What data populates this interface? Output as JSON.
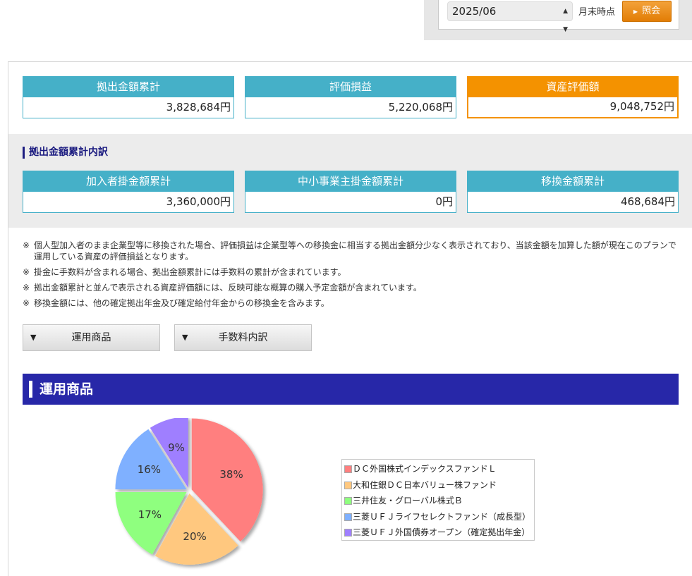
{
  "date_selector": {
    "value": "2025/06",
    "suffix": "月末時点",
    "button_label": "照会"
  },
  "summary": {
    "contribution_total": {
      "label": "拠出金額累計",
      "value": "3,828,684円"
    },
    "valuation_gain": {
      "label": "評価損益",
      "value": "5,220,068円"
    },
    "asset_value": {
      "label": "資産評価額",
      "value": "9,048,752円"
    }
  },
  "breakdown": {
    "title": "拠出金額累計内訳",
    "member_total": {
      "label": "加入者掛金額累計",
      "value": "3,360,000円"
    },
    "employer_total": {
      "label": "中小事業主掛金額累計",
      "value": "0円"
    },
    "transfer_total": {
      "label": "移換金額累計",
      "value": "468,684円"
    }
  },
  "notes": [
    {
      "mark": "※",
      "text": "個人型加入者のまま企業型等に移換された場合、評価損益は企業型等への移換金に相当する拠出金額分少なく表示されており、当該金額を加算した額が現在このプランで運用している資産の評価損益となります。"
    },
    {
      "mark": "※",
      "text": "掛金に手数料が含まれる場合、拠出金額累計には手数料の累計が含まれています。"
    },
    {
      "mark": "※",
      "text": "拠出金額累計と並んで表示される資産評価額には、反映可能な概算の購入予定金額が含まれています。"
    },
    {
      "mark": "※",
      "text": "移換金額には、他の確定拠出年金及び確定給付年金からの移換金を含みます。"
    }
  ],
  "toggles": {
    "products": "運用商品",
    "fees": "手数料内訳",
    "arrow": "▼"
  },
  "section": {
    "title": "運用商品"
  },
  "chart_data": {
    "type": "pie",
    "series": [
      {
        "name": "ＤＣ外国株式インデックスファンドＬ",
        "value": 38,
        "label": "38%",
        "color": "#ff7f7f"
      },
      {
        "name": "大和住銀ＤＣ日本バリュー株ファンド",
        "value": 20,
        "label": "20%",
        "color": "#ffc87f"
      },
      {
        "name": "三井住友・グローバル株式Ｂ",
        "value": 17,
        "label": "17%",
        "color": "#8fff7f"
      },
      {
        "name": "三菱ＵＦＪライフセレクトファンド（成長型）",
        "value": 16,
        "label": "16%",
        "color": "#7fb0ff"
      },
      {
        "name": "三菱ＵＦＪ外国債券オープン（確定拠出年金）",
        "value": 9,
        "label": "9%",
        "color": "#9f7fff"
      }
    ],
    "legend_position": "right"
  }
}
